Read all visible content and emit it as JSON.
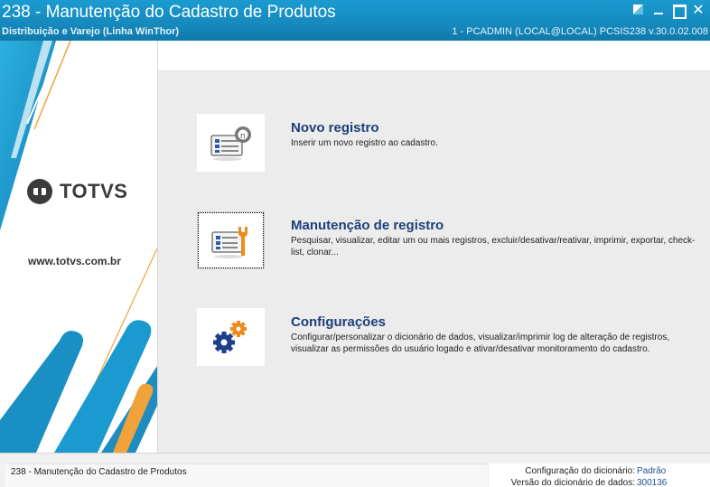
{
  "window": {
    "title": "238 - Manutenção do Cadastro de Produtos",
    "subtitle": "Distribuição e Varejo (Linha WinThor)",
    "session": "1 - PCADMIN (LOCAL@LOCAL)   PCSIS238  v.30.0.02.008"
  },
  "brand": {
    "logo_text": "TOTVS",
    "website": "www.totvs.com.br"
  },
  "actions": [
    {
      "title": "Novo registro",
      "description": "Inserir um novo registro ao cadastro.",
      "icon": "new-record-form-icon"
    },
    {
      "title": "Manutenção de registro",
      "description": "Pesquisar, visualizar, editar um ou mais registros, excluir/desativar/reativar, imprimir, exportar, check-list,  clonar...",
      "icon": "maintenance-form-wrench-icon"
    },
    {
      "title": "Configurações",
      "description": "Configurar/personalizar o dicionário de dados, visualizar/imprimir log de alteração de registros, visualizar as permissões do usuário logado e ativar/desativar monitoramento do cadastro.",
      "icon": "settings-gears-icon"
    }
  ],
  "status": {
    "left_text": "238 - Manutenção do Cadastro de Produtos",
    "config_label": "Configuração do dicionário:",
    "config_value": "Padrão",
    "version_label": "Versão do dicionário de dados:",
    "version_value": "300136"
  },
  "colors": {
    "title_bar": "#1689bd",
    "action_title": "#1c3f7a",
    "brand_blue": "#1b9ad0",
    "brand_orange": "#f0a33a"
  }
}
